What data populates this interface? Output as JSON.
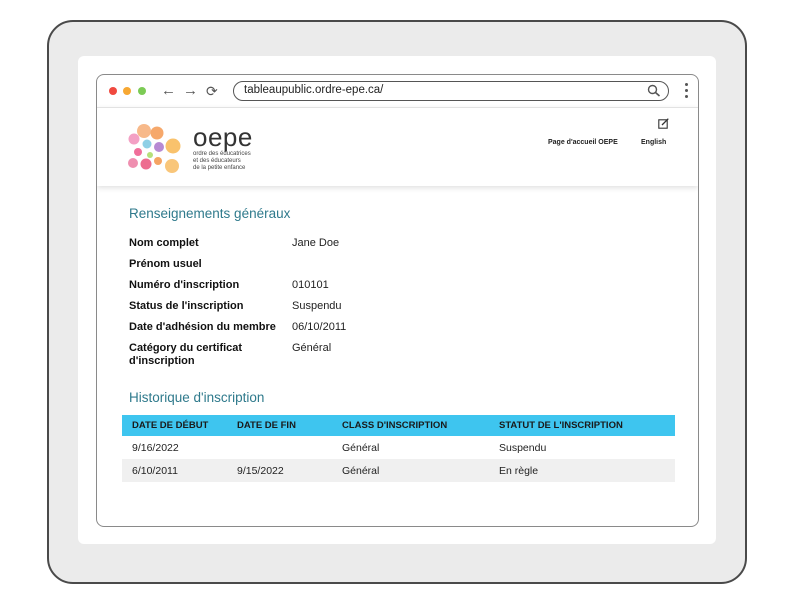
{
  "browser": {
    "url": "tableaupublic.ordre-epe.ca/",
    "dots": [
      "#f0493f",
      "#f7a833",
      "#7ccb55"
    ]
  },
  "header": {
    "logo_word": "oepe",
    "logo_sub": [
      "ordre des éducatrices",
      "et des éducateurs",
      "de la petite enfance"
    ],
    "link_home": "Page d'accueil OEPE",
    "link_english": "English"
  },
  "general": {
    "title": "Renseignements généraux",
    "fields": [
      {
        "label": "Nom complet",
        "value": "Jane Doe"
      },
      {
        "label": "Prénom usuel",
        "value": ""
      },
      {
        "label": "Numéro d'inscription",
        "value": "010101"
      },
      {
        "label": "Status de l'inscription",
        "value": "Suspendu"
      },
      {
        "label": "Date d'adhésion du membre",
        "value": "06/10/2011"
      },
      {
        "label": "Catégory du certificat d'inscription",
        "value": "Général"
      }
    ]
  },
  "history": {
    "title": "Historique d'inscription",
    "columns": [
      "DATE DE DÉBUT",
      "DATE DE FIN",
      "CLASS D'INSCRIPTION",
      "STATUT DE L'INSCRIPTION"
    ],
    "rows": [
      [
        "9/16/2022",
        "",
        "Général",
        "Suspendu"
      ],
      [
        "6/10/2011",
        "9/15/2022",
        "Général",
        "En règle"
      ]
    ]
  },
  "colors": {
    "accent": "#2f7a8c",
    "table_header": "#3ec5ef"
  }
}
